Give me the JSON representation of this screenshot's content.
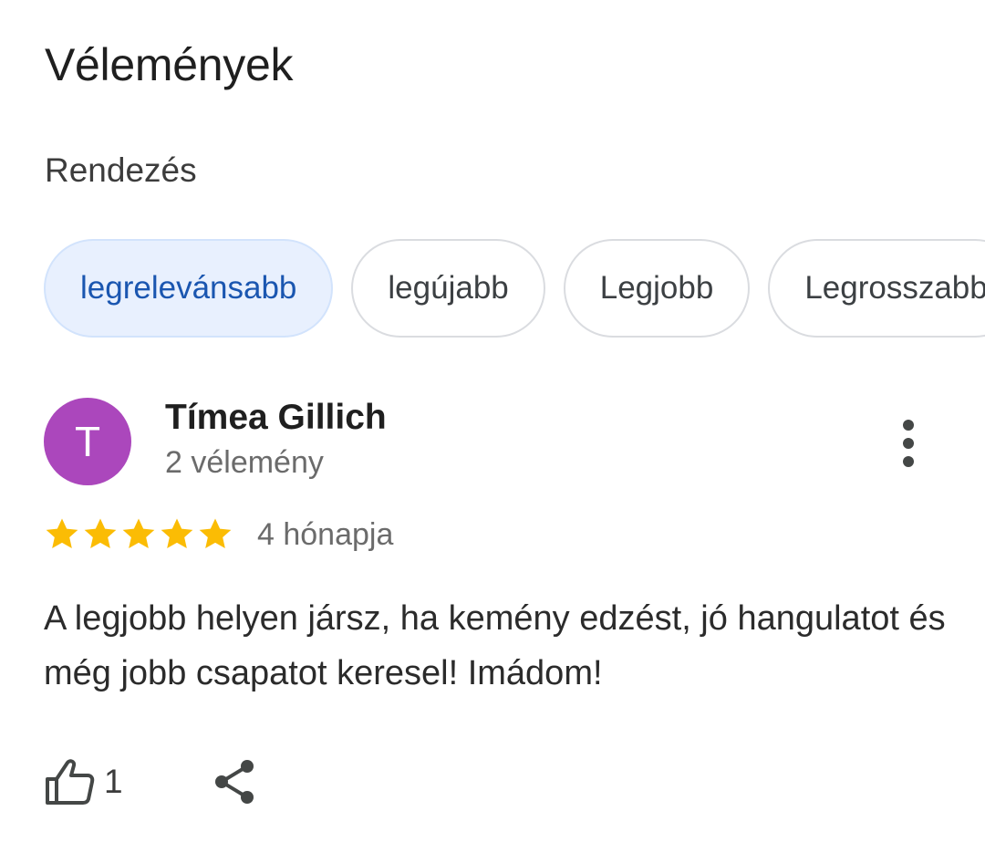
{
  "header": {
    "title": "Vélemények",
    "sort_label": "Rendezés"
  },
  "sort_chips": [
    {
      "label": "legrelevánsabb",
      "selected": true
    },
    {
      "label": "legújabb",
      "selected": false
    },
    {
      "label": "Legjobb",
      "selected": false
    },
    {
      "label": "Legrosszabb",
      "selected": false
    }
  ],
  "review": {
    "avatar_initial": "T",
    "avatar_color": "#ab47bc",
    "author": "Tímea Gillich",
    "author_meta": "2 vélemény",
    "rating": 5,
    "rating_max": 5,
    "time": "4 hónapja",
    "text": "A legjobb helyen jársz, ha kemény edzést, jó hangulatot és még jobb csapatot keresel! Imádom!",
    "likes": "1",
    "icons": {
      "more": "more-vert-icon",
      "like": "thumb-up-icon",
      "share": "share-icon",
      "star": "star-icon"
    }
  },
  "colors": {
    "star": "#fbbc04",
    "selected_chip_bg": "#e8f0fe",
    "selected_chip_text": "#1a56b0"
  }
}
